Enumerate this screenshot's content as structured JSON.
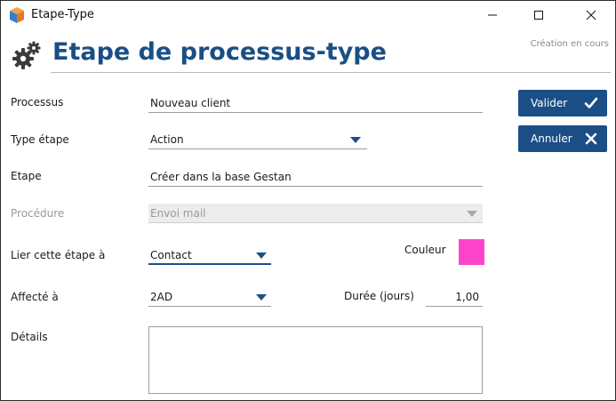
{
  "window": {
    "title": "Etape-Type",
    "icons": {
      "app": "app-cube-icon",
      "minimize": "minimize-icon",
      "maximize": "maximize-icon",
      "close": "close-icon"
    }
  },
  "header": {
    "title": "Etape de processus-type",
    "status": "Création en cours",
    "icon": "gears-icon",
    "title_color": "#1a4f86"
  },
  "form": {
    "processus": {
      "label": "Processus",
      "value": "Nouveau client"
    },
    "type_etape": {
      "label": "Type étape",
      "value": "Action"
    },
    "etape": {
      "label": "Etape",
      "value": "Créer dans la base Gestan"
    },
    "procedure": {
      "label": "Procédure",
      "value": "Envoi mail",
      "disabled": true
    },
    "lier": {
      "label": "Lier cette étape à",
      "value": "Contact"
    },
    "couleur": {
      "label": "Couleur",
      "color": "#ff44cc"
    },
    "affecte": {
      "label": "Affecté à",
      "value": "2AD"
    },
    "duree": {
      "label": "Durée (jours)",
      "value": "1,00"
    },
    "details": {
      "label": "Détails",
      "value": ""
    }
  },
  "buttons": {
    "valider": {
      "label": "Valider",
      "icon": "check-icon"
    },
    "annuler": {
      "label": "Annuler",
      "icon": "x-icon"
    },
    "color": "#1b4e85"
  }
}
